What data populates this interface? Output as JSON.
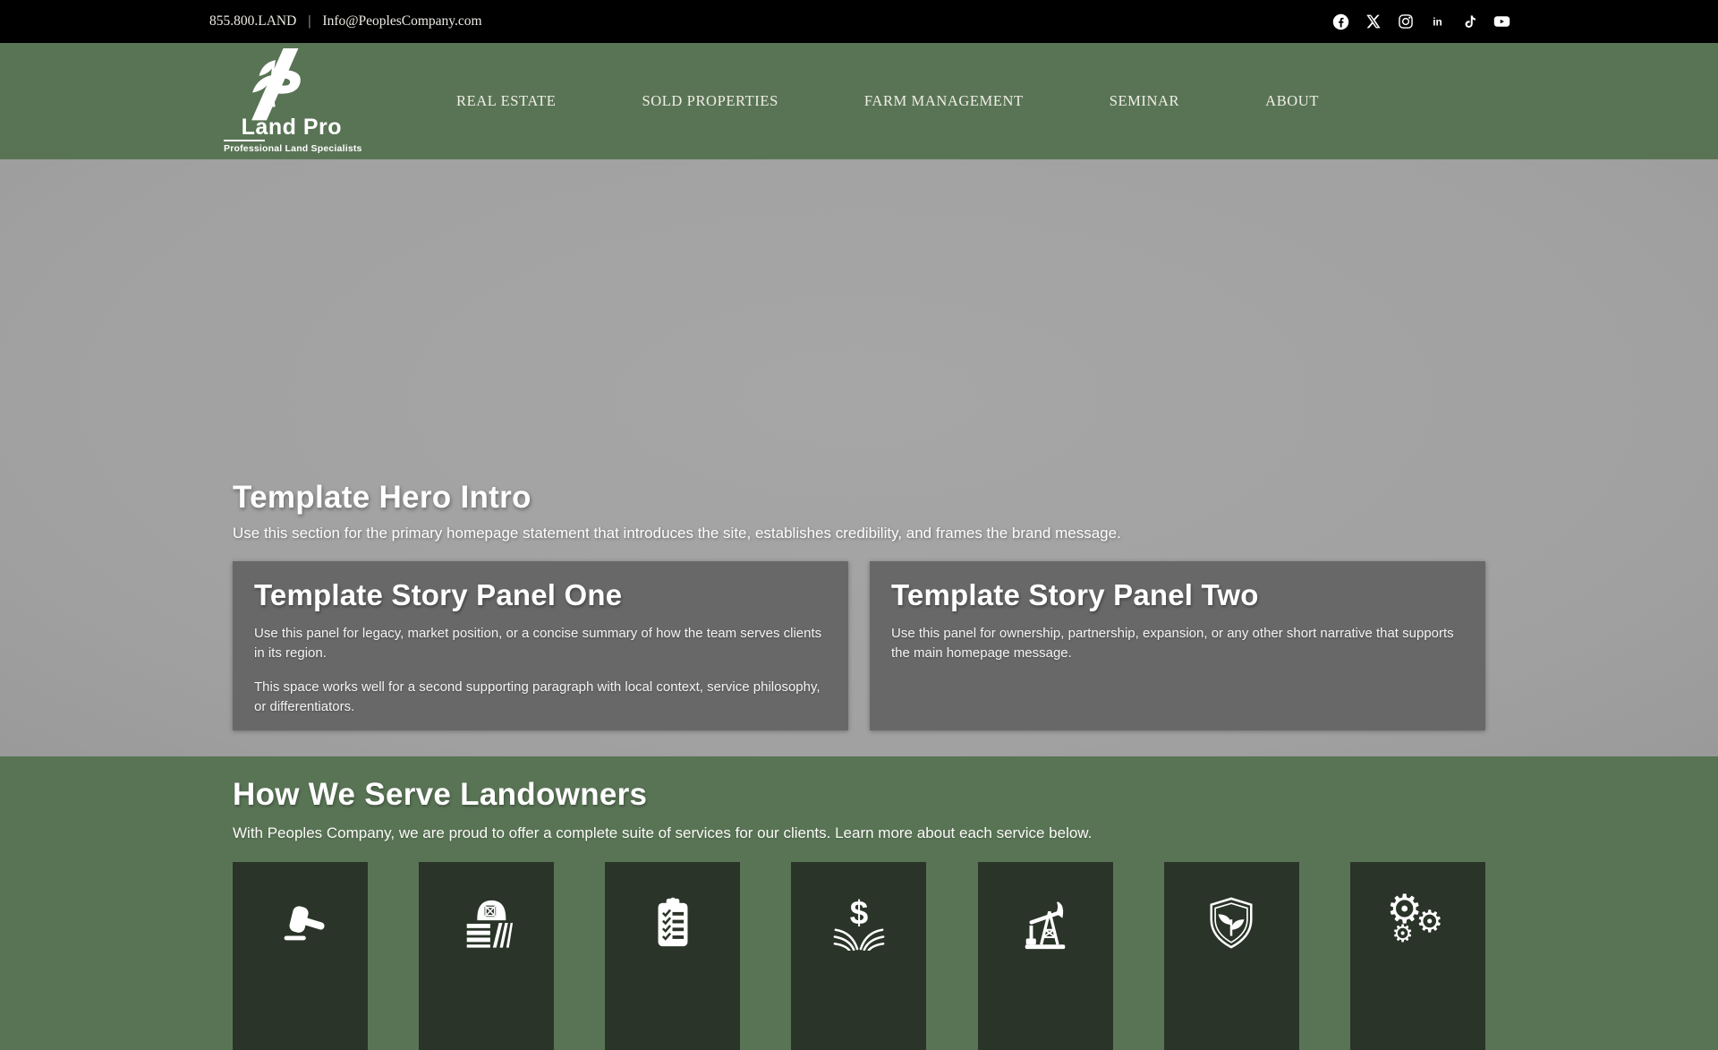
{
  "colors": {
    "brand-green": "#597455",
    "tile-green": "#2a3428",
    "hero-gray": "#a1a1a1",
    "panel-gray": "#686868",
    "bar-black": "#000000",
    "text-light": "#eceae2"
  },
  "icons": {
    "gear": "⚙",
    "linkedin": "in",
    "dollar": "$"
  },
  "topbar": {
    "phone": "855.800.LAND",
    "separator": "|",
    "email": "Info@PeoplesCompany.com",
    "social": [
      {
        "name": "facebook"
      },
      {
        "name": "x-twitter"
      },
      {
        "name": "instagram"
      },
      {
        "name": "linkedin"
      },
      {
        "name": "tiktok"
      },
      {
        "name": "youtube"
      }
    ]
  },
  "nav": {
    "logo": {
      "title": "Land Pro",
      "tagline": "Professional Land Specialists"
    },
    "items": [
      {
        "label": "REAL ESTATE"
      },
      {
        "label": "SOLD PROPERTIES"
      },
      {
        "label": "FARM MANAGEMENT"
      },
      {
        "label": "SEMINAR"
      },
      {
        "label": "ABOUT"
      }
    ]
  },
  "hero": {
    "title": "Template Hero Intro",
    "subtitle": "Use this section for the primary homepage statement that introduces the site, establishes credibility, and frames the brand message.",
    "panels": [
      {
        "title": "Template Story Panel One",
        "paragraphs": [
          "Use this panel for legacy, market position, or a concise summary of how the team serves clients in its region.",
          "This space works well for a second supporting paragraph with local context, service philosophy, or differentiators."
        ]
      },
      {
        "title": "Template Story Panel Two",
        "paragraphs": [
          "Use this panel for ownership, partnership, expansion, or any other short narrative that supports the main homepage message."
        ]
      }
    ]
  },
  "services": {
    "title": "How We Serve Landowners",
    "subtitle": "With Peoples Company, we are proud to offer a complete suite of services for our clients. Learn more about each service below.",
    "tiles": [
      {
        "icon": "gavel-icon"
      },
      {
        "icon": "barn-fields-icon"
      },
      {
        "icon": "clipboard-checklist-icon"
      },
      {
        "icon": "dollar-field-icon"
      },
      {
        "icon": "oil-derrick-icon"
      },
      {
        "icon": "shield-sprout-icon"
      },
      {
        "icon": "gears-icon"
      }
    ]
  }
}
